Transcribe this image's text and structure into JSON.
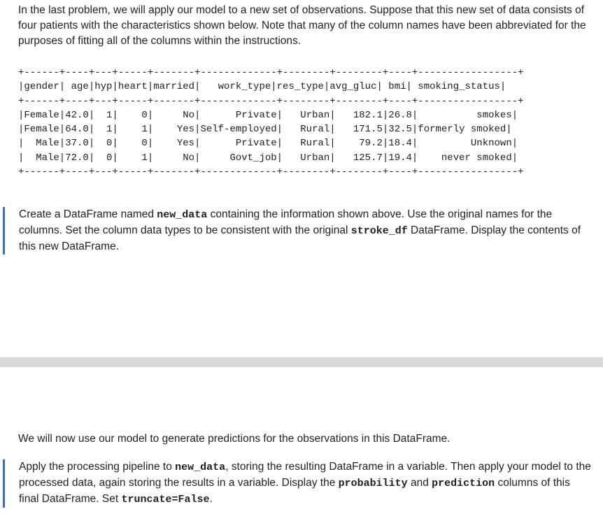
{
  "intro": "In the last problem, we will apply our model to a new set of observations. Suppose that this new set of data consists of four patients with the characteristics shown below. Note that many of the column names have been abbreviated for the purposes of fitting all of the columns within the instructions.",
  "table_text": "+------+----+---+-----+-------+-------------+--------+--------+----+-----------------+\n|gender| age|hyp|heart|married|   work_type|res_type|avg_gluc| bmi| smoking_status|\n+------+----+---+-----+-------+-------------+--------+--------+----+-----------------+\n|Female|42.0|  1|    0|     No|      Private|   Urban|   182.1|26.8|          smokes|\n|Female|64.0|  1|    1|    Yes|Self-employed|   Rural|   171.5|32.5|formerly smoked|\n|  Male|37.0|  0|    0|    Yes|      Private|   Rural|    79.2|18.4|         Unknown|\n|  Male|72.0|  0|    1|     No|     Govt_job|   Urban|   125.7|19.4|    never smoked|\n+------+----+---+-----+-------+-------------+--------+--------+----+-----------------+",
  "task1": {
    "t1": "Create a DataFrame named ",
    "c1": "new_data",
    "t2": " containing the information shown above. Use the original names for the columns. Set the column data types to be consistent with the original ",
    "c2": "stroke_df",
    "t3": " DataFrame. Display the contents of this new DataFrame."
  },
  "section2": "We will now use our model to generate predictions for the observations in this DataFrame.",
  "task2": {
    "t1": "Apply the processing pipeline to ",
    "c1": "new_data",
    "t2": ", storing the resulting DataFrame in a variable. Then apply your model to the processed data, again storing the results in a variable. Display the ",
    "c2": "probability",
    "t3": " and ",
    "c3": "prediction",
    "t4": " columns of this final DataFrame. Set ",
    "c4": "truncate=False",
    "t5": "."
  }
}
